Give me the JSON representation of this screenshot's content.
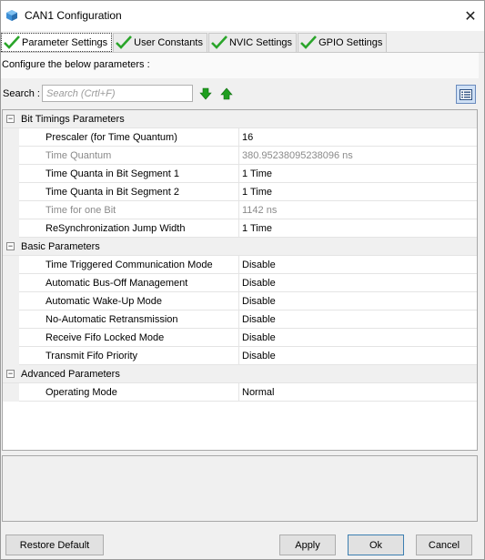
{
  "window": {
    "title": "CAN1 Configuration",
    "close_glyph": "✕"
  },
  "tabs": [
    {
      "label": "Parameter Settings",
      "active": true
    },
    {
      "label": "User Constants",
      "active": false
    },
    {
      "label": "NVIC Settings",
      "active": false
    },
    {
      "label": "GPIO Settings",
      "active": false
    }
  ],
  "intro_text": "Configure the below parameters :",
  "search": {
    "label": "Search :",
    "placeholder": "Search (Crtl+F)"
  },
  "groups": [
    {
      "name": "Bit Timings Parameters",
      "toggle": "⊟",
      "params": [
        {
          "name": "Prescaler (for Time Quantum)",
          "value": "16",
          "disabled": false
        },
        {
          "name": "Time Quantum",
          "value": "380.95238095238096 ns",
          "disabled": true
        },
        {
          "name": "Time Quanta in Bit Segment 1",
          "value": "1 Time",
          "disabled": false
        },
        {
          "name": "Time Quanta in Bit Segment 2",
          "value": "1 Time",
          "disabled": false
        },
        {
          "name": "Time for one Bit",
          "value": "1142 ns",
          "disabled": true
        },
        {
          "name": "ReSynchronization Jump Width",
          "value": "1 Time",
          "disabled": false
        }
      ]
    },
    {
      "name": "Basic Parameters",
      "toggle": "⊟",
      "params": [
        {
          "name": "Time Triggered Communication Mode",
          "value": "Disable",
          "disabled": false
        },
        {
          "name": "Automatic Bus-Off Management",
          "value": "Disable",
          "disabled": false
        },
        {
          "name": "Automatic Wake-Up Mode",
          "value": "Disable",
          "disabled": false
        },
        {
          "name": "No-Automatic Retransmission",
          "value": "Disable",
          "disabled": false
        },
        {
          "name": "Receive Fifo Locked Mode",
          "value": "Disable",
          "disabled": false
        },
        {
          "name": "Transmit Fifo Priority",
          "value": "Disable",
          "disabled": false
        }
      ]
    },
    {
      "name": "Advanced Parameters",
      "toggle": "⊟",
      "params": [
        {
          "name": "Operating Mode",
          "value": "Normal",
          "disabled": false
        }
      ]
    }
  ],
  "buttons": {
    "restore_default": "Restore Default",
    "apply": "Apply",
    "ok": "Ok",
    "cancel": "Cancel"
  },
  "colors": {
    "check_green": "#2aa52a",
    "arrow_green": "#1e9e1e",
    "disabled_text": "#8a8a8a"
  }
}
